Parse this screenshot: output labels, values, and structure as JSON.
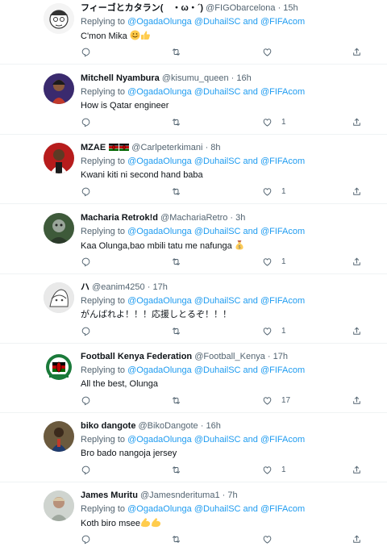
{
  "reply_prefix": "Replying to",
  "mention_1": "@OgadaOlunga",
  "mention_2": "@DuhailSC",
  "mention_joiner": "and",
  "mention_3": "@FIFAcom",
  "colors": {
    "link": "#1d9bf0",
    "secondary": "#536471",
    "text": "#0f1419",
    "divider": "#eff3f4"
  },
  "tweets": [
    {
      "name": "フィーゴとカタラン(　・ω・´)",
      "handle": "@FIGObarcelona",
      "sep": "·",
      "time": "15h",
      "text": "C'mon Mika",
      "emoji": [
        "smiling-face",
        "thumbs-up"
      ],
      "like_count": ""
    },
    {
      "name": "Mitchell Nyambura",
      "handle": "@kisumu_queen",
      "sep": "·",
      "time": "16h",
      "text": "How is Qatar engineer",
      "emoji": [],
      "like_count": "1"
    },
    {
      "name": "MZAE",
      "handle": "@Carlpeterkimani",
      "sep": "·",
      "time": "8h",
      "text": "Kwani kiti ni second hand baba",
      "emoji": [],
      "like_count": "1",
      "flags": [
        "kenya-flag",
        "kenya-flag"
      ]
    },
    {
      "name": "Macharia Retrok!d",
      "handle": "@MachariaRetro",
      "sep": "·",
      "time": "3h",
      "text": "Kaa Olunga,bao mbili tatu me nafunga ",
      "emoji": [
        "money-bag"
      ],
      "like_count": "1"
    },
    {
      "name": "ハ",
      "handle": "@eanim4250",
      "sep": "·",
      "time": "17h",
      "text": "がんばれよ！！！応援しとるぞ！！！",
      "emoji": [],
      "like_count": "1"
    },
    {
      "name": "Football Kenya Federation",
      "handle": "@Football_Kenya",
      "sep": "·",
      "time": "17h",
      "text": "All the best, Olunga",
      "emoji": [],
      "like_count": "17"
    },
    {
      "name": "biko dangote",
      "handle": "@BikoDangote",
      "sep": "·",
      "time": "16h",
      "text": "Bro bado nangoja jersey",
      "emoji": [],
      "like_count": "1"
    },
    {
      "name": "James Muritu",
      "handle": "@Jamesnderituma1",
      "sep": "·",
      "time": "7h",
      "text": "Koth biro msee",
      "emoji": [
        "flexed-biceps",
        "flexed-biceps"
      ],
      "like_count": ""
    }
  ],
  "icons": {
    "reply": "reply-icon",
    "retweet": "retweet-icon",
    "like": "heart-icon",
    "share": "share-icon"
  }
}
